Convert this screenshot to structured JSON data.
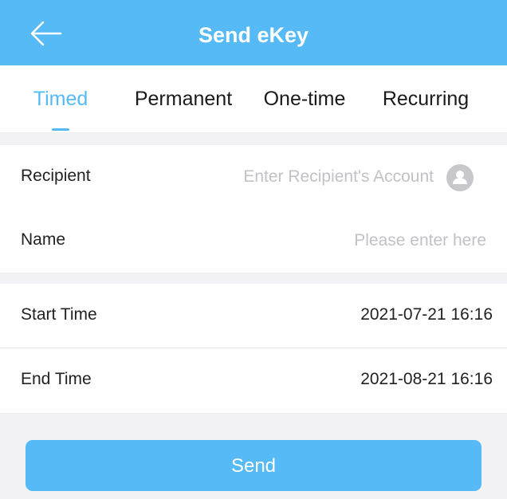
{
  "header": {
    "title": "Send eKey",
    "back_icon": "arrow-left-icon"
  },
  "tabs": [
    {
      "label": "Timed",
      "active": true
    },
    {
      "label": "Permanent",
      "active": false
    },
    {
      "label": "One-time",
      "active": false
    },
    {
      "label": "Recurring",
      "active": false
    }
  ],
  "form": {
    "recipient": {
      "label": "Recipient",
      "placeholder": "Enter Recipient's Account",
      "value": "",
      "icon": "contact-icon"
    },
    "name": {
      "label": "Name",
      "placeholder": "Please enter here",
      "value": ""
    },
    "start_time": {
      "label": "Start Time",
      "value": "2021-07-21 16:16"
    },
    "end_time": {
      "label": "End Time",
      "value": "2021-08-21 16:16"
    }
  },
  "send_button": {
    "label": "Send"
  },
  "colors": {
    "primary": "#56baf7",
    "background": "#f2f2f4",
    "placeholder": "#c2c2c6"
  }
}
